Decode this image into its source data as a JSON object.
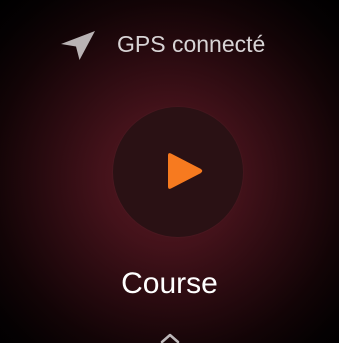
{
  "status": {
    "gps_label": "GPS connecté",
    "gps_icon": "navigation-arrow-icon",
    "gps_icon_color": "#b9b3b4"
  },
  "main": {
    "start_button_icon": "play-icon",
    "play_color": "#f77a1f",
    "button_color": "#2a1114",
    "activity_label": "Course"
  },
  "footer": {
    "swipe_icon": "chevron-up-icon"
  },
  "colors": {
    "background_center": "#5a1a23",
    "background_edge": "#000000"
  }
}
